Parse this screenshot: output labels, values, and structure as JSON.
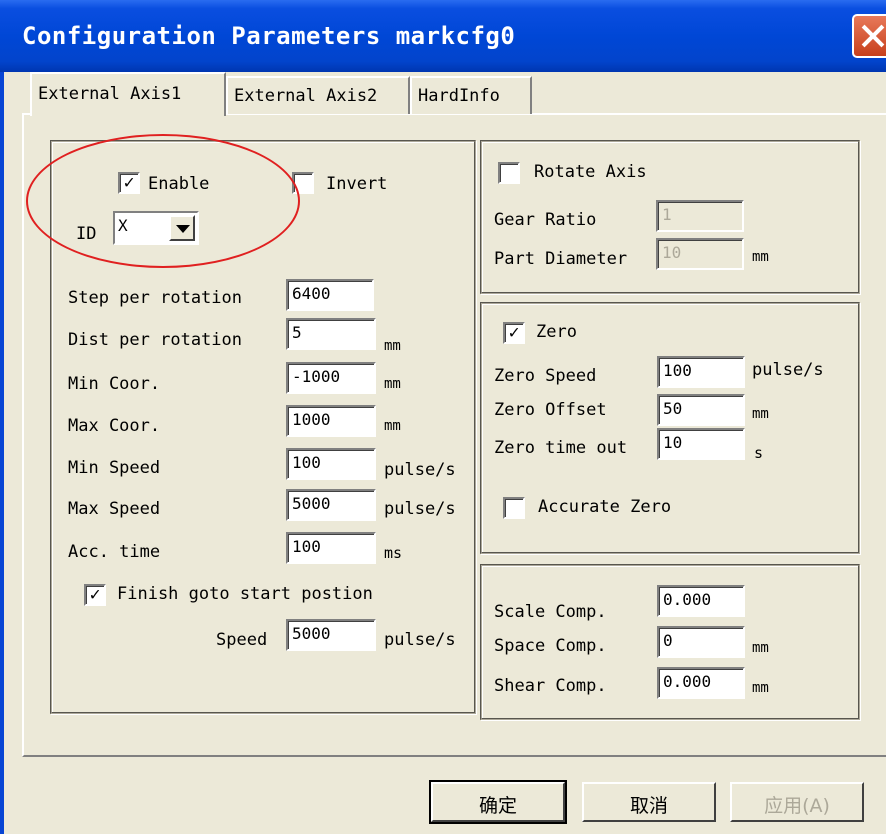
{
  "window": {
    "title": "Configuration Parameters markcfg0"
  },
  "tabs": [
    "External Axis1",
    "External Axis2",
    "HardInfo"
  ],
  "axis_group": {
    "enable_label": "Enable",
    "enable_checked": true,
    "invert_label": "Invert",
    "invert_checked": false,
    "id_label": "ID",
    "id_value": "X",
    "step_per_rotation_label": "Step per rotation",
    "step_per_rotation": "6400",
    "dist_per_rotation_label": "Dist per rotation",
    "dist_per_rotation": "5",
    "dist_unit": "mm",
    "min_coor_label": "Min Coor.",
    "min_coor": "-1000",
    "min_coor_unit": "mm",
    "max_coor_label": "Max Coor.",
    "max_coor": "1000",
    "max_coor_unit": "mm",
    "min_speed_label": "Min Speed",
    "min_speed": "100",
    "min_speed_unit": "pulse/s",
    "max_speed_label": "Max Speed",
    "max_speed": "5000",
    "max_speed_unit": "pulse/s",
    "acc_time_label": "Acc. time",
    "acc_time": "100",
    "acc_time_unit": "ms",
    "finish_label": "Finish goto start postion",
    "finish_checked": true,
    "speed_label": "Speed",
    "speed": "5000",
    "speed_unit": "pulse/s"
  },
  "rotate_group": {
    "rotate_label": "Rotate Axis",
    "rotate_checked": false,
    "gear_ratio_label": "Gear Ratio",
    "gear_ratio": "1",
    "part_diameter_label": "Part Diameter",
    "part_diameter": "10",
    "part_diameter_unit": "mm"
  },
  "zero_group": {
    "zero_label": "Zero",
    "zero_checked": true,
    "zero_speed_label": "Zero Speed",
    "zero_speed": "100",
    "zero_speed_unit": "pulse/s",
    "zero_offset_label": "Zero Offset",
    "zero_offset": "50",
    "zero_offset_unit": "mm",
    "zero_timeout_label": "Zero time out",
    "zero_timeout": "10",
    "zero_timeout_unit": "s",
    "accurate_label": "Accurate Zero",
    "accurate_checked": false
  },
  "comp_group": {
    "scale_label": "Scale Comp.",
    "scale": "0.000",
    "space_label": "Space Comp.",
    "space": "0",
    "space_unit": "mm",
    "shear_label": "Shear Comp.",
    "shear": "0.000",
    "shear_unit": "mm"
  },
  "buttons": {
    "ok": "确定",
    "cancel": "取消",
    "apply": "应用(A)"
  },
  "colors": {
    "titlebar": "#0047d6",
    "dialog_bg": "#ece9d8",
    "annotation": "#e02020"
  }
}
